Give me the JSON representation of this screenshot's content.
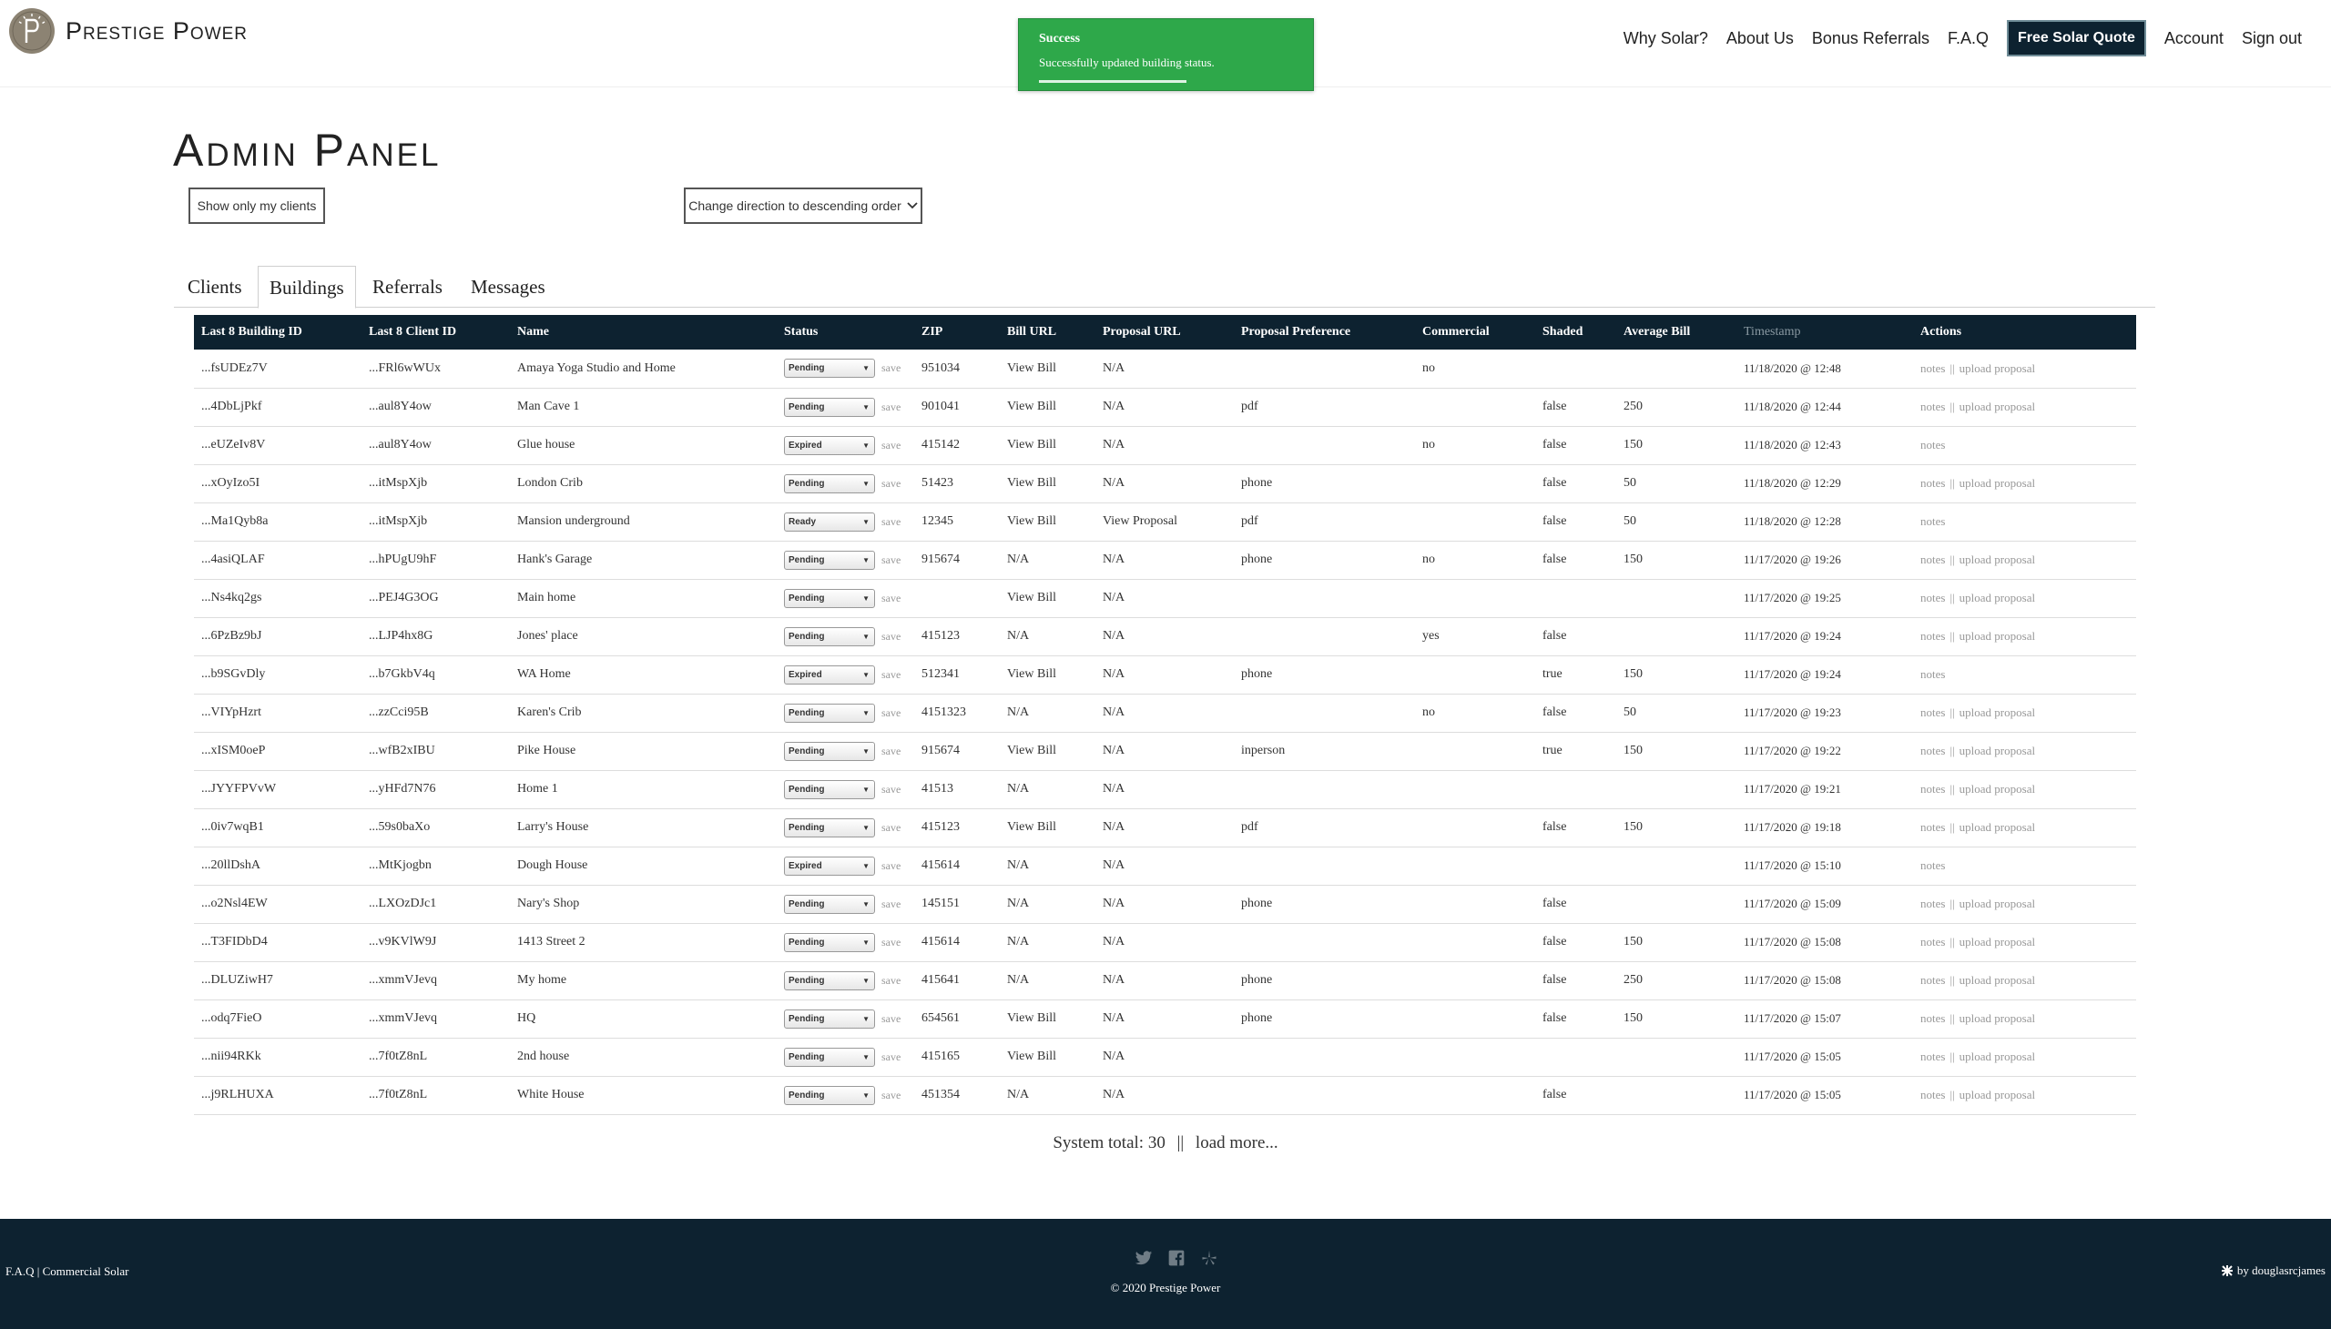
{
  "nav": {
    "brand": "Prestige Power",
    "links": [
      "Why Solar?",
      "About Us",
      "Bonus Referrals",
      "F.A.Q"
    ],
    "cta": "Free Solar Quote",
    "account": "Account",
    "signout": "Sign out"
  },
  "toast": {
    "title": "Success",
    "message": "Successfully updated building status.",
    "color": "#2ea84a"
  },
  "page": {
    "title": "Admin Panel",
    "my_clients_button": "Show only my clients",
    "direction_button": "Change direction to descending order"
  },
  "tabs": [
    "Clients",
    "Buildings",
    "Referrals",
    "Messages"
  ],
  "active_tab": "Buildings",
  "table": {
    "headers": [
      "Last 8 Building ID",
      "Last 8 Client ID",
      "Name",
      "Status",
      "ZIP",
      "Bill URL",
      "Proposal URL",
      "Proposal Preference",
      "Commercial",
      "Shaded",
      "Average Bill",
      "Timestamp",
      "Actions"
    ],
    "save_label": "save",
    "notes_label": "notes",
    "separator": "||",
    "upload_label": "upload proposal",
    "rows": [
      {
        "building": "...fsUDEz7V",
        "client": "...FRl6wWUx",
        "name": "Amaya Yoga Studio and Home",
        "status": "Pending",
        "zip": "951034",
        "bill": "View Bill",
        "proposal": "N/A",
        "pref": "",
        "commercial": "no",
        "shaded": "",
        "avg": "",
        "ts": "11/18/2020 @ 12:48",
        "upload": true
      },
      {
        "building": "...4DbLjPkf",
        "client": "...aul8Y4ow",
        "name": "Man Cave 1",
        "status": "Pending",
        "zip": "901041",
        "bill": "View Bill",
        "proposal": "N/A",
        "pref": "pdf",
        "commercial": "",
        "shaded": "false",
        "avg": "250",
        "ts": "11/18/2020 @ 12:44",
        "upload": true
      },
      {
        "building": "...eUZeIv8V",
        "client": "...aul8Y4ow",
        "name": "Glue house",
        "status": "Expired",
        "zip": "415142",
        "bill": "View Bill",
        "proposal": "N/A",
        "pref": "",
        "commercial": "no",
        "shaded": "false",
        "avg": "150",
        "ts": "11/18/2020 @ 12:43",
        "upload": false
      },
      {
        "building": "...xOyIzo5I",
        "client": "...itMspXjb",
        "name": "London Crib",
        "status": "Pending",
        "zip": "51423",
        "bill": "View Bill",
        "proposal": "N/A",
        "pref": "phone",
        "commercial": "",
        "shaded": "false",
        "avg": "50",
        "ts": "11/18/2020 @ 12:29",
        "upload": true
      },
      {
        "building": "...Ma1Qyb8a",
        "client": "...itMspXjb",
        "name": "Mansion underground",
        "status": "Ready",
        "zip": "12345",
        "bill": "View Bill",
        "proposal": "View Proposal",
        "pref": "pdf",
        "commercial": "",
        "shaded": "false",
        "avg": "50",
        "ts": "11/18/2020 @ 12:28",
        "upload": false
      },
      {
        "building": "...4asiQLAF",
        "client": "...hPUgU9hF",
        "name": "Hank's Garage",
        "status": "Pending",
        "zip": "915674",
        "bill": "N/A",
        "proposal": "N/A",
        "pref": "phone",
        "commercial": "no",
        "shaded": "false",
        "avg": "150",
        "ts": "11/17/2020 @ 19:26",
        "upload": true
      },
      {
        "building": "...Ns4kq2gs",
        "client": "...PEJ4G3OG",
        "name": "Main home",
        "status": "Pending",
        "zip": "",
        "bill": "View Bill",
        "proposal": "N/A",
        "pref": "",
        "commercial": "",
        "shaded": "",
        "avg": "",
        "ts": "11/17/2020 @ 19:25",
        "upload": true
      },
      {
        "building": "...6PzBz9bJ",
        "client": "...LJP4hx8G",
        "name": "Jones' place",
        "status": "Pending",
        "zip": "415123",
        "bill": "N/A",
        "proposal": "N/A",
        "pref": "",
        "commercial": "yes",
        "shaded": "false",
        "avg": "",
        "ts": "11/17/2020 @ 19:24",
        "upload": true
      },
      {
        "building": "...b9SGvDly",
        "client": "...b7GkbV4q",
        "name": "WA Home",
        "status": "Expired",
        "zip": "512341",
        "bill": "View Bill",
        "proposal": "N/A",
        "pref": "phone",
        "commercial": "",
        "shaded": "true",
        "avg": "150",
        "ts": "11/17/2020 @ 19:24",
        "upload": false
      },
      {
        "building": "...VIYpHzrt",
        "client": "...zzCci95B",
        "name": "Karen's Crib",
        "status": "Pending",
        "zip": "4151323",
        "bill": "N/A",
        "proposal": "N/A",
        "pref": "",
        "commercial": "no",
        "shaded": "false",
        "avg": "50",
        "ts": "11/17/2020 @ 19:23",
        "upload": true
      },
      {
        "building": "...xISM0oeP",
        "client": "...wfB2xIBU",
        "name": "Pike House",
        "status": "Pending",
        "zip": "915674",
        "bill": "View Bill",
        "proposal": "N/A",
        "pref": "inperson",
        "commercial": "",
        "shaded": "true",
        "avg": "150",
        "ts": "11/17/2020 @ 19:22",
        "upload": true
      },
      {
        "building": "...JYYFPVvW",
        "client": "...yHFd7N76",
        "name": "Home 1",
        "status": "Pending",
        "zip": "41513",
        "bill": "N/A",
        "proposal": "N/A",
        "pref": "",
        "commercial": "",
        "shaded": "",
        "avg": "",
        "ts": "11/17/2020 @ 19:21",
        "upload": true
      },
      {
        "building": "...0iv7wqB1",
        "client": "...59s0baXo",
        "name": "Larry's House",
        "status": "Pending",
        "zip": "415123",
        "bill": "View Bill",
        "proposal": "N/A",
        "pref": "pdf",
        "commercial": "",
        "shaded": "false",
        "avg": "150",
        "ts": "11/17/2020 @ 19:18",
        "upload": true
      },
      {
        "building": "...20llDshA",
        "client": "...MtKjogbn",
        "name": "Dough House",
        "status": "Expired",
        "zip": "415614",
        "bill": "N/A",
        "proposal": "N/A",
        "pref": "",
        "commercial": "",
        "shaded": "",
        "avg": "",
        "ts": "11/17/2020 @ 15:10",
        "upload": false
      },
      {
        "building": "...o2Nsl4EW",
        "client": "...LXOzDJc1",
        "name": "Nary's Shop",
        "status": "Pending",
        "zip": "145151",
        "bill": "N/A",
        "proposal": "N/A",
        "pref": "phone",
        "commercial": "",
        "shaded": "false",
        "avg": "",
        "ts": "11/17/2020 @ 15:09",
        "upload": true
      },
      {
        "building": "...T3FIDbD4",
        "client": "...v9KVlW9J",
        "name": "1413 Street 2",
        "status": "Pending",
        "zip": "415614",
        "bill": "N/A",
        "proposal": "N/A",
        "pref": "",
        "commercial": "",
        "shaded": "false",
        "avg": "150",
        "ts": "11/17/2020 @ 15:08",
        "upload": true
      },
      {
        "building": "...DLUZiwH7",
        "client": "...xmmVJevq",
        "name": "My home",
        "status": "Pending",
        "zip": "415641",
        "bill": "N/A",
        "proposal": "N/A",
        "pref": "phone",
        "commercial": "",
        "shaded": "false",
        "avg": "250",
        "ts": "11/17/2020 @ 15:08",
        "upload": true
      },
      {
        "building": "...odq7FieO",
        "client": "...xmmVJevq",
        "name": "HQ",
        "status": "Pending",
        "zip": "654561",
        "bill": "View Bill",
        "proposal": "N/A",
        "pref": "phone",
        "commercial": "",
        "shaded": "false",
        "avg": "150",
        "ts": "11/17/2020 @ 15:07",
        "upload": true
      },
      {
        "building": "...nii94RKk",
        "client": "...7f0tZ8nL",
        "name": "2nd house",
        "status": "Pending",
        "zip": "415165",
        "bill": "View Bill",
        "proposal": "N/A",
        "pref": "",
        "commercial": "",
        "shaded": "",
        "avg": "",
        "ts": "11/17/2020 @ 15:05",
        "upload": true
      },
      {
        "building": "...j9RLHUXA",
        "client": "...7f0tZ8nL",
        "name": "White House",
        "status": "Pending",
        "zip": "451354",
        "bill": "N/A",
        "proposal": "N/A",
        "pref": "",
        "commercial": "",
        "shaded": "false",
        "avg": "",
        "ts": "11/17/2020 @ 15:05",
        "upload": true
      }
    ]
  },
  "summary": {
    "total_text": "System total: 30",
    "separator": "||",
    "load_more": "load more..."
  },
  "footer": {
    "left": "F.A.Q | Commercial Solar",
    "copyright": "© 2020 Prestige Power",
    "credit": "by douglasrcjames",
    "icons": [
      "twitter-icon",
      "facebook-icon",
      "yelp-icon"
    ],
    "bg": "#0d2230"
  }
}
